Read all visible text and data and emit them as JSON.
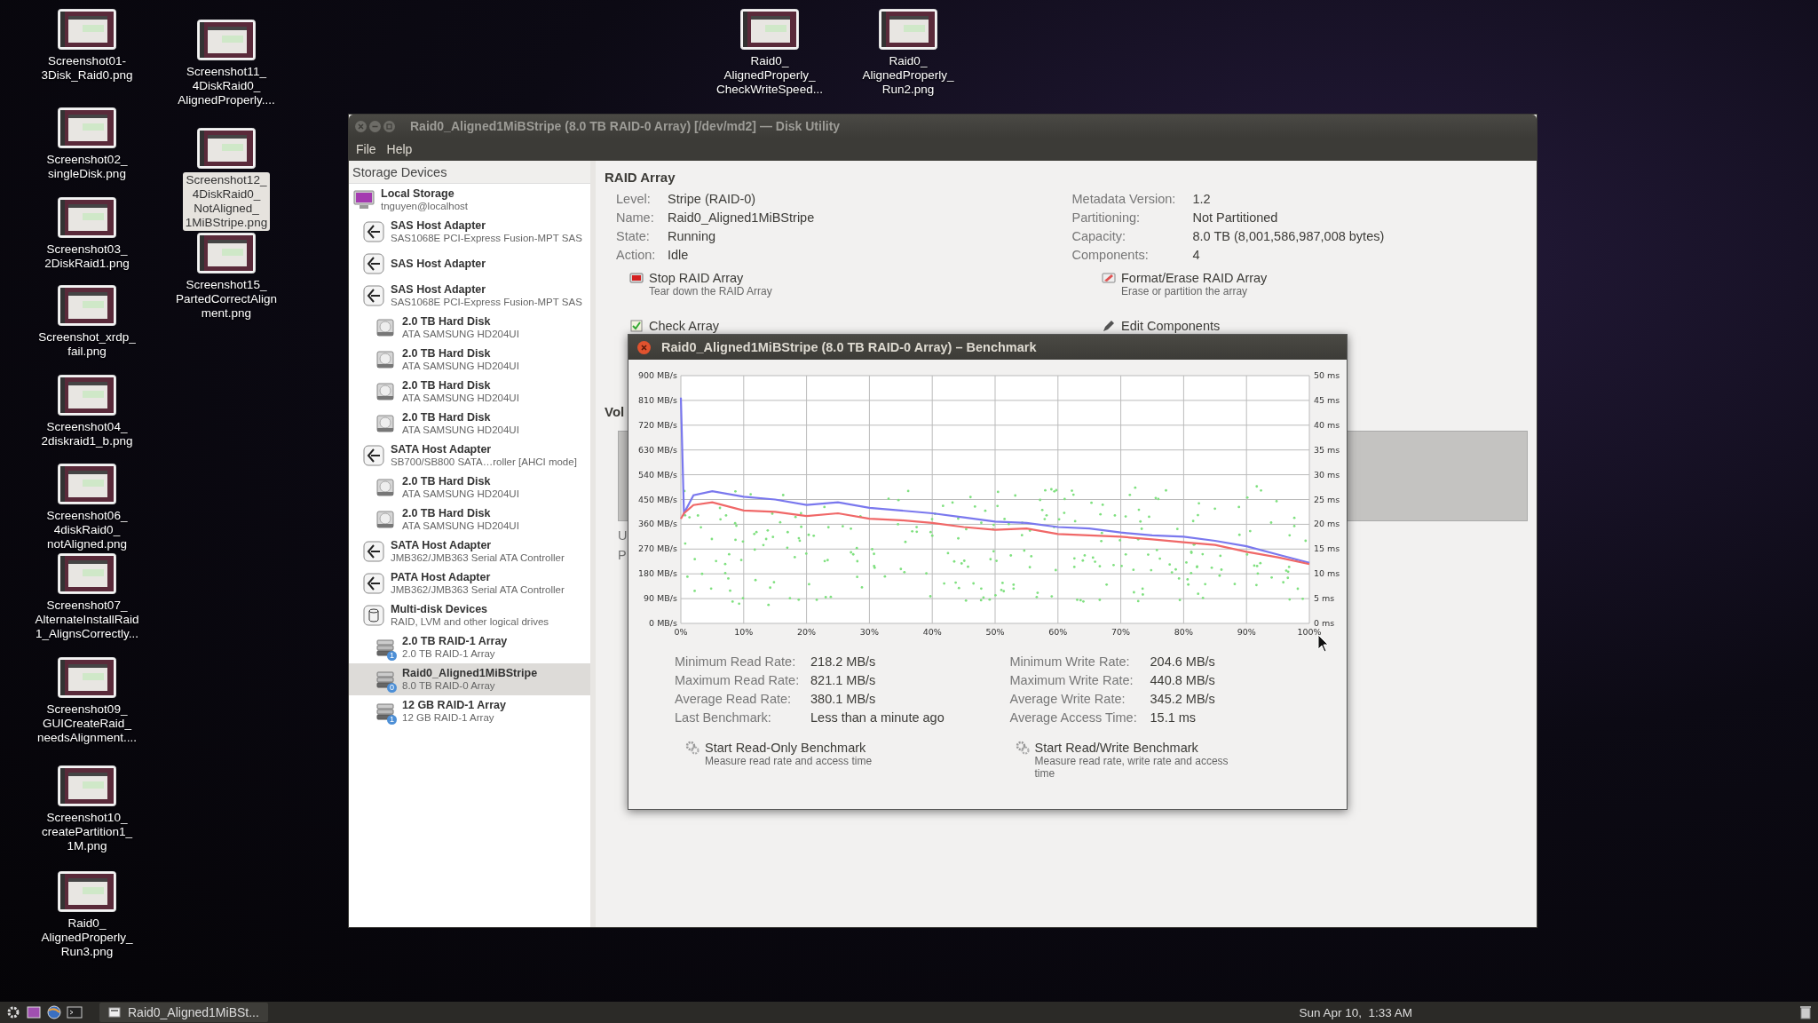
{
  "desktop_icons": [
    {
      "label": "Screenshot01-\n3Disk_Raid0.png",
      "selected": false
    },
    {
      "label": "Screenshot02_\nsingleDisk.png",
      "selected": false
    },
    {
      "label": "Screenshot03_\n2DiskRaid1.png",
      "selected": false
    },
    {
      "label": "Screenshot_xrdp_\nfail.png",
      "selected": false
    },
    {
      "label": "Screenshot04_\n2diskraid1_b.png",
      "selected": false
    },
    {
      "label": "Screenshot06_\n4diskRaid0_\nnotAligned.png",
      "selected": false
    },
    {
      "label": "Screenshot07_\nAlternateInstallRaid\n1_AlignsCorrectly...",
      "selected": false
    },
    {
      "label": "Screenshot09_\nGUICreateRaid_\nneedsAlignment....",
      "selected": false
    },
    {
      "label": "Screenshot10_\ncreatePartition1_\n1M.png",
      "selected": false
    },
    {
      "label": "Raid0_\nAlignedProperly_\nRun3.png",
      "selected": false
    },
    {
      "label": "Screenshot11_\n4DiskRaid0_\nAlignedProperly....",
      "selected": false
    },
    {
      "label": "Screenshot12_\n4DiskRaid0_\nNotAligned_\n1MiBStripe.png",
      "selected": true
    },
    {
      "label": "Screenshot15_\nPartedCorrectAlign\nment.png",
      "selected": false
    },
    {
      "label": "Raid0_\nAlignedProperly_\nCheckWriteSpeed...",
      "selected": false
    },
    {
      "label": "Raid0_\nAlignedProperly_\nRun2.png",
      "selected": false
    }
  ],
  "window": {
    "title": "Raid0_Aligned1MiBStripe (8.0 TB RAID-0 Array) [/dev/md2] — Disk Utility",
    "menu": [
      "File",
      "Help"
    ]
  },
  "sidebar": {
    "header": "Storage Devices",
    "items": [
      {
        "kind": "computer",
        "title": "Local Storage",
        "subtitle": "tnguyen@localhost",
        "selected": false,
        "children": [
          {
            "kind": "adapter",
            "title": "SAS Host Adapter",
            "subtitle": "SAS1068E PCI-Express Fusion-MPT SAS",
            "selected": false
          },
          {
            "kind": "adapter",
            "title": "SAS Host Adapter",
            "selected": false
          },
          {
            "kind": "adapter",
            "title": "SAS Host Adapter",
            "subtitle": "SAS1068E PCI-Express Fusion-MPT SAS",
            "selected": false,
            "children": [
              {
                "kind": "disk",
                "title": "2.0 TB Hard Disk",
                "subtitle": "ATA SAMSUNG HD204UI",
                "selected": false
              },
              {
                "kind": "disk",
                "title": "2.0 TB Hard Disk",
                "subtitle": "ATA SAMSUNG HD204UI",
                "selected": false
              },
              {
                "kind": "disk",
                "title": "2.0 TB Hard Disk",
                "subtitle": "ATA SAMSUNG HD204UI",
                "selected": false
              },
              {
                "kind": "disk",
                "title": "2.0 TB Hard Disk",
                "subtitle": "ATA SAMSUNG HD204UI",
                "selected": false
              }
            ]
          },
          {
            "kind": "adapter",
            "title": "SATA Host Adapter",
            "subtitle": "SB700/SB800 SATA…roller [AHCI mode]",
            "selected": false,
            "children": [
              {
                "kind": "disk",
                "title": "2.0 TB Hard Disk",
                "subtitle": "ATA SAMSUNG HD204UI",
                "selected": false
              },
              {
                "kind": "disk",
                "title": "2.0 TB Hard Disk",
                "subtitle": "ATA SAMSUNG HD204UI",
                "selected": false
              }
            ]
          },
          {
            "kind": "adapter",
            "title": "SATA Host Adapter",
            "subtitle": "JMB362/JMB363 Serial ATA Controller",
            "selected": false
          },
          {
            "kind": "adapter",
            "title": "PATA Host Adapter",
            "subtitle": "JMB362/JMB363 Serial ATA Controller",
            "selected": false
          },
          {
            "kind": "multidisk",
            "title": "Multi-disk Devices",
            "subtitle": "RAID, LVM and other logical drives",
            "selected": false,
            "children": [
              {
                "kind": "raid",
                "title": "2.0 TB RAID-1 Array",
                "subtitle": "2.0 TB RAID-1 Array",
                "badge": "1",
                "selected": false
              },
              {
                "kind": "raid",
                "title": "Raid0_Aligned1MiBStripe",
                "subtitle": "8.0 TB RAID-0 Array",
                "badge": "0",
                "selected": true
              },
              {
                "kind": "raid",
                "title": "12 GB RAID-1 Array",
                "subtitle": "12 GB RAID-1 Array",
                "badge": "1",
                "selected": false
              }
            ]
          }
        ]
      }
    ]
  },
  "raid_array": {
    "heading": "RAID Array",
    "left_fields": [
      {
        "label": "Level:",
        "value": "Stripe (RAID-0)"
      },
      {
        "label": "Name:",
        "value": "Raid0_Aligned1MiBStripe"
      },
      {
        "label": "State:",
        "value": "Running"
      },
      {
        "label": "Action:",
        "value": "Idle"
      }
    ],
    "right_fields": [
      {
        "label": "Metadata Version:",
        "value": "1.2"
      },
      {
        "label": "Partitioning:",
        "value": "Not Partitioned"
      },
      {
        "label": "Capacity:",
        "value": "8.0 TB (8,001,586,987,008 bytes)"
      },
      {
        "label": "Components:",
        "value": "4"
      }
    ],
    "actions": [
      {
        "kind": "stop",
        "title": "Stop RAID Array",
        "subtitle": "Tear down the RAID Array"
      },
      {
        "kind": "format",
        "title": "Format/Erase RAID Array",
        "subtitle": "Erase or partition the array"
      },
      {
        "kind": "check",
        "title": "Check Array"
      },
      {
        "kind": "edit",
        "title": "Edit Components"
      }
    ]
  },
  "volumes": {
    "heading": "Vol",
    "labels": [
      "U",
      "P"
    ]
  },
  "benchmark": {
    "title": "Raid0_Aligned1MiBStripe (8.0 TB RAID-0 Array) – Benchmark",
    "chart_data": {
      "type": "line",
      "grid": true,
      "xlim": [
        0,
        100
      ],
      "ylim": [
        0,
        900
      ],
      "x": [
        0,
        0.5,
        2,
        5,
        10,
        15,
        20,
        25,
        30,
        35,
        40,
        45,
        50,
        55,
        60,
        65,
        70,
        75,
        80,
        85,
        90,
        95,
        100
      ],
      "series": [
        {
          "color": "#7a78ee",
          "values": [
            820,
            400,
            465,
            480,
            460,
            450,
            430,
            440,
            420,
            410,
            400,
            385,
            370,
            365,
            350,
            345,
            330,
            320,
            315,
            300,
            280,
            250,
            220
          ]
        },
        {
          "color": "#f06868",
          "values": [
            380,
            400,
            430,
            440,
            410,
            405,
            390,
            400,
            380,
            375,
            365,
            350,
            340,
            345,
            325,
            320,
            315,
            305,
            295,
            285,
            260,
            240,
            215
          ]
        }
      ],
      "xticks": [
        {
          "value": 0,
          "label": "0%"
        },
        {
          "value": 10,
          "label": "10%"
        },
        {
          "value": 20,
          "label": "20%"
        },
        {
          "value": 30,
          "label": "30%"
        },
        {
          "value": 40,
          "label": "40%"
        },
        {
          "value": 50,
          "label": "50%"
        },
        {
          "value": 60,
          "label": "60%"
        },
        {
          "value": 70,
          "label": "70%"
        },
        {
          "value": 80,
          "label": "80%"
        },
        {
          "value": 90,
          "label": "90%"
        },
        {
          "value": 100,
          "label": "100%"
        }
      ],
      "yticks": [
        {
          "value": 0,
          "label": "0 MB/s"
        },
        {
          "value": 90,
          "label": "90 MB/s"
        },
        {
          "value": 180,
          "label": "180 MB/s"
        },
        {
          "value": 270,
          "label": "270 MB/s"
        },
        {
          "value": 360,
          "label": "360 MB/s"
        },
        {
          "value": 450,
          "label": "450 MB/s"
        },
        {
          "value": 540,
          "label": "540 MB/s"
        },
        {
          "value": 630,
          "label": "630 MB/s"
        },
        {
          "value": 720,
          "label": "720 MB/s"
        },
        {
          "value": 810,
          "label": "810 MB/s"
        },
        {
          "value": 900,
          "label": "900 MB/s"
        }
      ]
    },
    "access_time_axis": [
      "50 ms",
      "45 ms",
      "40 ms",
      "35 ms",
      "30 ms",
      "25 ms",
      "20 ms",
      "15 ms",
      "10 ms",
      "5 ms",
      "0 ms"
    ],
    "stats_left": [
      {
        "label": "Minimum Read Rate:",
        "value": "218.2 MB/s"
      },
      {
        "label": "Maximum Read Rate:",
        "value": "821.1 MB/s"
      },
      {
        "label": "Average Read Rate:",
        "value": "380.1 MB/s"
      },
      {
        "label": "Last Benchmark:",
        "value": "Less than a minute ago"
      }
    ],
    "stats_right": [
      {
        "label": "Minimum Write Rate:",
        "value": "204.6 MB/s"
      },
      {
        "label": "Maximum Write Rate:",
        "value": "440.8 MB/s"
      },
      {
        "label": "Average Write Rate:",
        "value": "345.2 MB/s"
      },
      {
        "label": "Average Access Time:",
        "value": "15.1 ms"
      }
    ],
    "buttons": [
      {
        "title": "Start Read-Only Benchmark",
        "subtitle": "Measure read rate and access time"
      },
      {
        "title": "Start Read/Write Benchmark",
        "subtitle": "Measure read rate, write rate and access time"
      }
    ]
  },
  "taskbar": {
    "task": "Raid0_Aligned1MiBSt...",
    "clock": "Sun Apr 10,  1:33 AM"
  }
}
